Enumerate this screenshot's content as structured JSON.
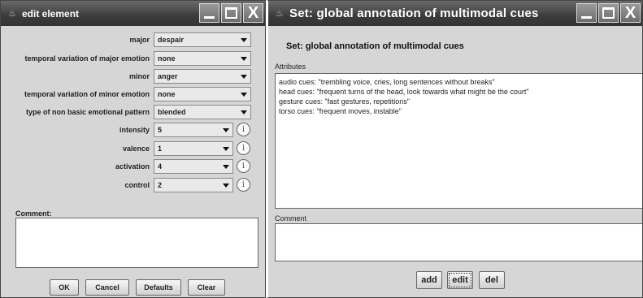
{
  "left_window": {
    "title": "edit element",
    "fields": [
      {
        "label": "major",
        "value": "despair"
      },
      {
        "label": "temporal variation of major emotion",
        "value": "none"
      },
      {
        "label": "minor",
        "value": "anger"
      },
      {
        "label": "temporal variation of minor emotion",
        "value": "none"
      },
      {
        "label": "type of non basic emotional pattern",
        "value": "blended"
      },
      {
        "label": "intensity",
        "value": "5"
      },
      {
        "label": "valence",
        "value": "1"
      },
      {
        "label": "activation",
        "value": "4"
      },
      {
        "label": "control",
        "value": "2"
      }
    ],
    "info_glyph": "i",
    "comment_label": "Comment:",
    "comment_value": "",
    "buttons": {
      "ok": "OK",
      "cancel": "Cancel",
      "defaults": "Defaults",
      "clear": "Clear"
    }
  },
  "right_window": {
    "title": "Set: global annotation of multimodal cues",
    "heading": "Set: global annotation of multimodal cues",
    "attributes_label": "Attributes",
    "attributes": [
      "audio cues: \"trembling voice, cries, long sentences without breaks\"",
      "head cues: \"frequent turns of the head, look towards what might be the court\"",
      "gesture cues: \"fast gestures, repetitions\"",
      "torso cues: \"frequent moves, instable\""
    ],
    "comment_label": "Comment",
    "comment_value": "",
    "buttons": {
      "add": "add",
      "edit": "edit",
      "del": "del"
    }
  },
  "title_buttons": {
    "close_glyph": "X"
  },
  "icons": [
    "window-icon",
    "minimize-icon",
    "maximize-icon",
    "close-icon",
    "info-icon",
    "dropdown-arrow-icon"
  ],
  "colors": {
    "titlebar": "#3c3c3c",
    "window_bg": "#d6d6d6"
  }
}
